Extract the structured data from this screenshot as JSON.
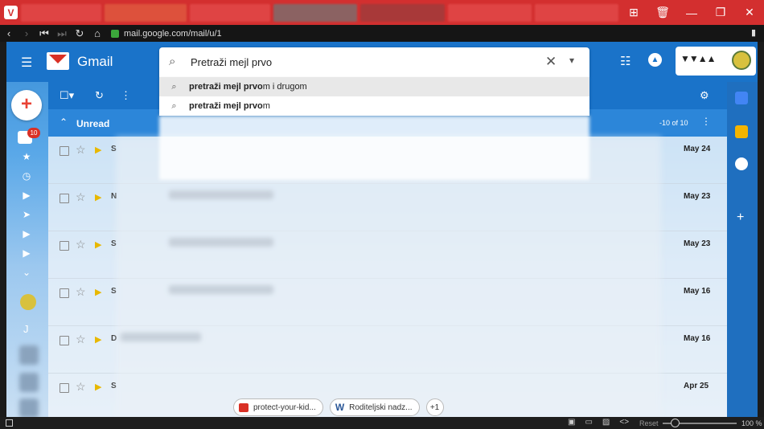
{
  "browser": {
    "url": "mail.google.com/mail/u/1",
    "zoom": "100 %",
    "reset_label": "Reset"
  },
  "gmail": {
    "title": "Gmail",
    "search": {
      "value": "Pretraži mejl prvo",
      "suggestions": [
        {
          "bold": "pretraži mejl prvo",
          "rest": "m i drugom"
        },
        {
          "bold": "pretraži mejl prvo",
          "rest": "m"
        }
      ]
    },
    "inbox_badge": "10",
    "rail_letter": "J",
    "section": {
      "label": "Unread",
      "count": "-10 of 10"
    },
    "rows": [
      {
        "sender": "S",
        "date": "May 24"
      },
      {
        "sender": "N",
        "date": "May 23"
      },
      {
        "sender": "S",
        "date": "May 23"
      },
      {
        "sender": "S",
        "date": "May 16"
      },
      {
        "sender": "D",
        "date": "May 16"
      },
      {
        "sender": "S",
        "date": "Apr 25"
      }
    ],
    "attachments": [
      {
        "label": "protect-your-kid...",
        "icon": "image-icon",
        "color": "#d93025"
      },
      {
        "label": "Roditeljski nadz...",
        "icon": "word-icon",
        "color": "#2b5797"
      }
    ],
    "attachments_more": "+1"
  },
  "colors": {
    "accent": "#1a73c9",
    "brand_red": "#d32f2f",
    "important": "#e8b800"
  }
}
